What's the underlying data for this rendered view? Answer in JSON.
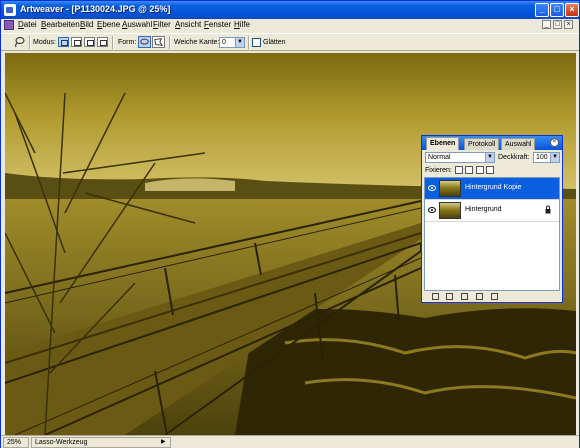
{
  "window": {
    "title": "Artweaver - [P1130024.JPG @ 25%]",
    "minimize": "_",
    "maximize": "□",
    "close": "×"
  },
  "menubar": {
    "items": [
      "Datei",
      "Bearbeiten",
      "Bild",
      "Ebene",
      "Auswahl",
      "Filter",
      "Ansicht",
      "Fenster",
      "Hilfe"
    ],
    "doc_buttons": [
      "_",
      "□",
      "×"
    ]
  },
  "toolbar": {
    "mode_label": "Modus:",
    "shape_label": "Form:",
    "feather_label": "Weiche Kante:",
    "feather_value": "0",
    "smooth_label": "Glätten",
    "smooth_checked": false
  },
  "layers_panel": {
    "tabs": [
      "Ebenen",
      "Protokoll",
      "Auswahl"
    ],
    "active_tab": "Ebenen",
    "blend_mode": "Normal",
    "opacity_label": "Deckkraft:",
    "opacity_value": "100",
    "lock_label": "Fixieren:",
    "layers": [
      {
        "name": "Hintergrund Kopie",
        "selected": true,
        "visible": true,
        "locked": false
      },
      {
        "name": "Hintergrund",
        "selected": false,
        "visible": true,
        "locked": true
      }
    ]
  },
  "statusbar": {
    "zoom": "25%",
    "tool": "Lasso-Werkzeug"
  },
  "colors": {
    "title_blue": "#0553d9",
    "selection_blue": "#0a5fe0",
    "sepia_dark": "#3a3106",
    "sepia_light": "#d9c766"
  },
  "icons": [
    "lasso-icon",
    "eye-icon",
    "lock-icon",
    "new-layer-icon",
    "trash-icon"
  ]
}
